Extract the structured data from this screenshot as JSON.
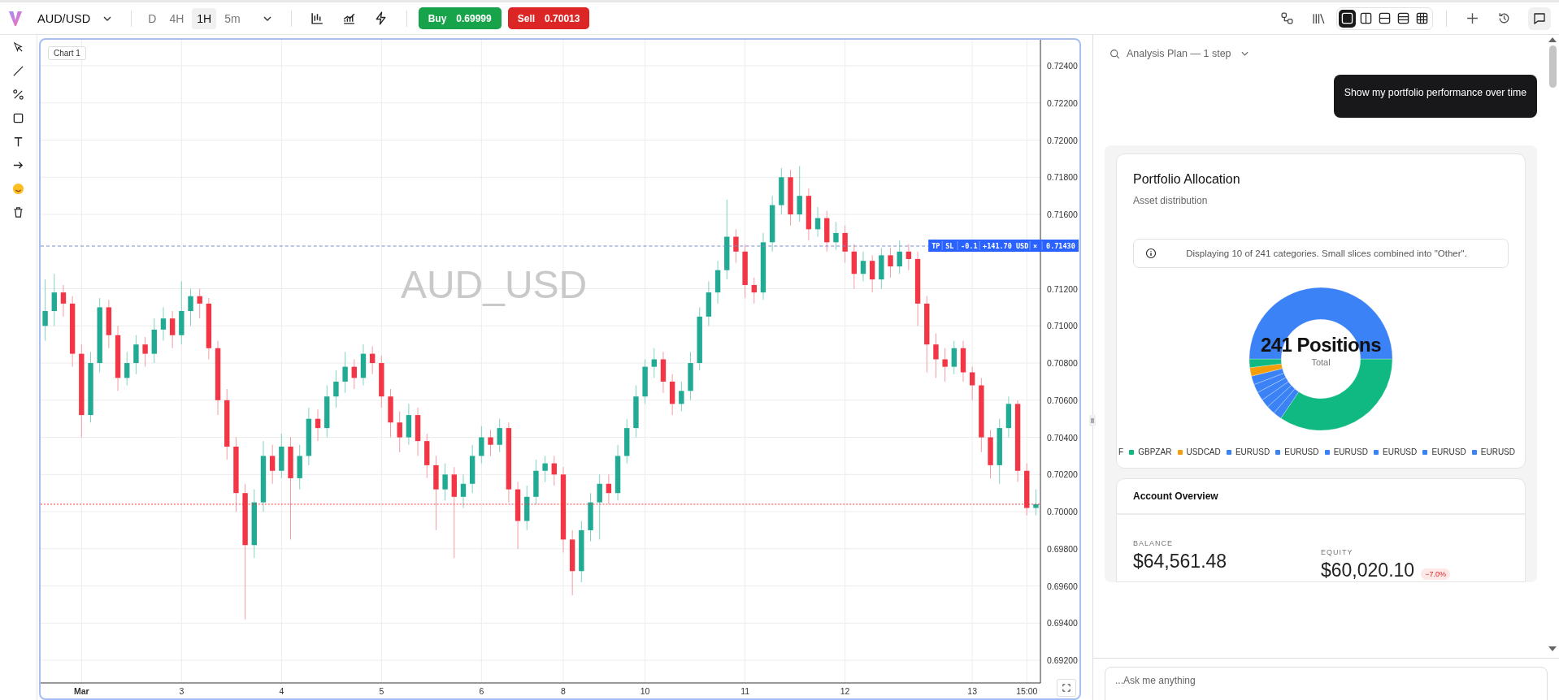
{
  "toolbar": {
    "symbol": "AUD/USD",
    "timeframes": [
      {
        "label": "D",
        "selected": false
      },
      {
        "label": "4H",
        "selected": false
      },
      {
        "label": "1H",
        "selected": true
      },
      {
        "label": "5m",
        "selected": false
      }
    ],
    "buy": {
      "label": "Buy",
      "price": "0.69999"
    },
    "sell": {
      "label": "Sell",
      "price": "0.70013"
    },
    "layouts": [
      {
        "kind": "single",
        "selected": true
      },
      {
        "kind": "columns",
        "selected": false
      },
      {
        "kind": "rows",
        "selected": false
      },
      {
        "kind": "three-rows",
        "selected": false
      },
      {
        "kind": "grid",
        "selected": false
      }
    ],
    "chat_open": true
  },
  "chart": {
    "tag": "Chart 1",
    "watermark": "AUD_USD",
    "chart_data": {
      "type": "candlestick",
      "ylim": [
        0.69078,
        0.7254
      ],
      "grid": true,
      "categories": [
        null,
        null,
        null,
        null,
        "Mar",
        null,
        null,
        null,
        null,
        null,
        null,
        null,
        null,
        null,
        null,
        "3",
        null,
        null,
        null,
        null,
        null,
        null,
        null,
        null,
        null,
        null,
        "4",
        null,
        null,
        null,
        null,
        null,
        null,
        null,
        null,
        null,
        null,
        "5",
        null,
        null,
        null,
        null,
        null,
        null,
        null,
        null,
        null,
        null,
        "6",
        null,
        null,
        null,
        null,
        null,
        null,
        null,
        null,
        "8",
        null,
        null,
        null,
        null,
        null,
        null,
        null,
        null,
        "10",
        null,
        null,
        null,
        null,
        null,
        null,
        null,
        null,
        null,
        null,
        "11",
        null,
        null,
        null,
        null,
        null,
        null,
        null,
        null,
        null,
        null,
        "12",
        null,
        null,
        null,
        null,
        null,
        null,
        null,
        null,
        null,
        null,
        null,
        null,
        null,
        "13",
        null,
        null,
        null,
        null,
        null,
        "15:00",
        null
      ],
      "ohlc": [
        [
          0.71,
          0.7125,
          0.7092,
          0.7108
        ],
        [
          0.7108,
          0.7128,
          0.71,
          0.7118
        ],
        [
          0.7118,
          0.7122,
          0.7105,
          0.7112
        ],
        [
          0.7112,
          0.7116,
          0.7078,
          0.7085
        ],
        [
          0.7085,
          0.709,
          0.704,
          0.7052
        ],
        [
          0.7052,
          0.7086,
          0.7048,
          0.708
        ],
        [
          0.708,
          0.7115,
          0.7075,
          0.711
        ],
        [
          0.711,
          0.7114,
          0.7088,
          0.7095
        ],
        [
          0.7095,
          0.71,
          0.7065,
          0.7072
        ],
        [
          0.7072,
          0.7086,
          0.7068,
          0.708
        ],
        [
          0.708,
          0.7095,
          0.7074,
          0.709
        ],
        [
          0.709,
          0.7094,
          0.7078,
          0.7085
        ],
        [
          0.7085,
          0.7104,
          0.708,
          0.7098
        ],
        [
          0.7098,
          0.711,
          0.7092,
          0.7104
        ],
        [
          0.7104,
          0.7108,
          0.7088,
          0.7095
        ],
        [
          0.7095,
          0.7124,
          0.709,
          0.7108
        ],
        [
          0.7108,
          0.712,
          0.71,
          0.7116
        ],
        [
          0.7116,
          0.712,
          0.7104,
          0.7112
        ],
        [
          0.7112,
          0.7115,
          0.7082,
          0.7088
        ],
        [
          0.7088,
          0.7092,
          0.7052,
          0.706
        ],
        [
          0.706,
          0.7066,
          0.7028,
          0.7035
        ],
        [
          0.7035,
          0.704,
          0.7,
          0.701
        ],
        [
          0.701,
          0.7015,
          0.6942,
          0.6982
        ],
        [
          0.6982,
          0.7012,
          0.6975,
          0.7005
        ],
        [
          0.7005,
          0.7038,
          0.7,
          0.703
        ],
        [
          0.703,
          0.7036,
          0.7015,
          0.7022
        ],
        [
          0.7022,
          0.7042,
          0.7018,
          0.7035
        ],
        [
          0.7035,
          0.704,
          0.6985,
          0.7018
        ],
        [
          0.7018,
          0.7036,
          0.7012,
          0.703
        ],
        [
          0.703,
          0.7056,
          0.7025,
          0.705
        ],
        [
          0.705,
          0.7055,
          0.7038,
          0.7045
        ],
        [
          0.7045,
          0.7068,
          0.704,
          0.7062
        ],
        [
          0.7062,
          0.7076,
          0.7056,
          0.707
        ],
        [
          0.707,
          0.7086,
          0.7064,
          0.7078
        ],
        [
          0.7078,
          0.7082,
          0.7066,
          0.7072
        ],
        [
          0.7072,
          0.709,
          0.7068,
          0.7085
        ],
        [
          0.7085,
          0.7089,
          0.7074,
          0.708
        ],
        [
          0.708,
          0.7084,
          0.7056,
          0.7062
        ],
        [
          0.7062,
          0.7066,
          0.704,
          0.7048
        ],
        [
          0.7048,
          0.7054,
          0.7032,
          0.704
        ],
        [
          0.704,
          0.7058,
          0.7036,
          0.7052
        ],
        [
          0.7052,
          0.7056,
          0.703,
          0.7038
        ],
        [
          0.7038,
          0.7042,
          0.7018,
          0.7025
        ],
        [
          0.7025,
          0.703,
          0.699,
          0.7012
        ],
        [
          0.7012,
          0.7026,
          0.7006,
          0.702
        ],
        [
          0.702,
          0.7024,
          0.6975,
          0.7008
        ],
        [
          0.7008,
          0.702,
          0.7002,
          0.7015
        ],
        [
          0.7015,
          0.7036,
          0.701,
          0.703
        ],
        [
          0.703,
          0.7046,
          0.7026,
          0.704
        ],
        [
          0.704,
          0.7044,
          0.703,
          0.7036
        ],
        [
          0.7036,
          0.705,
          0.7032,
          0.7045
        ],
        [
          0.7045,
          0.7048,
          0.7005,
          0.7012
        ],
        [
          0.7012,
          0.7016,
          0.698,
          0.6995
        ],
        [
          0.6995,
          0.7014,
          0.699,
          0.7008
        ],
        [
          0.7008,
          0.7028,
          0.7004,
          0.7022
        ],
        [
          0.7022,
          0.703,
          0.7016,
          0.7026
        ],
        [
          0.7026,
          0.703,
          0.7014,
          0.702
        ],
        [
          0.702,
          0.7024,
          0.6978,
          0.6985
        ],
        [
          0.6985,
          0.699,
          0.6955,
          0.6968
        ],
        [
          0.6968,
          0.6995,
          0.6962,
          0.699
        ],
        [
          0.699,
          0.701,
          0.6984,
          0.7005
        ],
        [
          0.7005,
          0.702,
          0.6985,
          0.7015
        ],
        [
          0.7015,
          0.702,
          0.7004,
          0.701
        ],
        [
          0.701,
          0.7036,
          0.7006,
          0.703
        ],
        [
          0.703,
          0.705,
          0.7026,
          0.7045
        ],
        [
          0.7045,
          0.7068,
          0.704,
          0.7062
        ],
        [
          0.7062,
          0.7082,
          0.7058,
          0.7078
        ],
        [
          0.7078,
          0.7088,
          0.7072,
          0.7082
        ],
        [
          0.7082,
          0.7086,
          0.7064,
          0.707
        ],
        [
          0.707,
          0.7074,
          0.7052,
          0.7058
        ],
        [
          0.7058,
          0.707,
          0.7054,
          0.7065
        ],
        [
          0.7065,
          0.7086,
          0.706,
          0.708
        ],
        [
          0.708,
          0.711,
          0.7076,
          0.7105
        ],
        [
          0.7105,
          0.7124,
          0.71,
          0.7118
        ],
        [
          0.7118,
          0.7135,
          0.7112,
          0.713
        ],
        [
          0.713,
          0.7168,
          0.7125,
          0.7148
        ],
        [
          0.7148,
          0.7152,
          0.7134,
          0.714
        ],
        [
          0.714,
          0.7144,
          0.7115,
          0.7122
        ],
        [
          0.7122,
          0.7126,
          0.7112,
          0.7118
        ],
        [
          0.7118,
          0.715,
          0.7114,
          0.7145
        ],
        [
          0.7145,
          0.717,
          0.714,
          0.7165
        ],
        [
          0.7165,
          0.7185,
          0.716,
          0.718
        ],
        [
          0.718,
          0.7184,
          0.7154,
          0.716
        ],
        [
          0.716,
          0.7186,
          0.7156,
          0.717
        ],
        [
          0.717,
          0.7174,
          0.7146,
          0.7152
        ],
        [
          0.7152,
          0.7164,
          0.7148,
          0.7158
        ],
        [
          0.7158,
          0.7162,
          0.714,
          0.7145
        ],
        [
          0.7145,
          0.7156,
          0.7141,
          0.715
        ],
        [
          0.715,
          0.7154,
          0.7134,
          0.714
        ],
        [
          0.714,
          0.7144,
          0.712,
          0.7128
        ],
        [
          0.7128,
          0.714,
          0.7124,
          0.7135
        ],
        [
          0.7135,
          0.7138,
          0.7118,
          0.7125
        ],
        [
          0.7125,
          0.7142,
          0.712,
          0.7138
        ],
        [
          0.7138,
          0.7142,
          0.7126,
          0.7132
        ],
        [
          0.7132,
          0.7146,
          0.7128,
          0.714
        ],
        [
          0.714,
          0.7144,
          0.713,
          0.7136
        ],
        [
          0.7136,
          0.714,
          0.71,
          0.7112
        ],
        [
          0.7112,
          0.7116,
          0.7075,
          0.709
        ],
        [
          0.709,
          0.7096,
          0.7072,
          0.7082
        ],
        [
          0.7082,
          0.7088,
          0.707,
          0.7078
        ],
        [
          0.7078,
          0.7092,
          0.7074,
          0.7088
        ],
        [
          0.7088,
          0.7092,
          0.707,
          0.7075
        ],
        [
          0.7075,
          0.7078,
          0.706,
          0.7068
        ],
        [
          0.7068,
          0.7072,
          0.7032,
          0.704
        ],
        [
          0.704,
          0.7044,
          0.7018,
          0.7025
        ],
        [
          0.7025,
          0.705,
          0.7015,
          0.7045
        ],
        [
          0.7045,
          0.7062,
          0.704,
          0.7058
        ],
        [
          0.7058,
          0.706,
          0.7016,
          0.7022
        ],
        [
          0.7022,
          0.7026,
          0.6998,
          0.7002
        ],
        [
          0.7002,
          0.7012,
          0.6998,
          0.7004
        ]
      ],
      "yticks": [
        {
          "value": 0.724,
          "label": "0.72400"
        },
        {
          "value": 0.722,
          "label": "0.72200"
        },
        {
          "value": 0.72,
          "label": "0.72000"
        },
        {
          "value": 0.718,
          "label": "0.71800"
        },
        {
          "value": 0.716,
          "label": "0.71600"
        },
        {
          "value": 0.712,
          "label": "0.71200"
        },
        {
          "value": 0.71,
          "label": "0.71000"
        },
        {
          "value": 0.708,
          "label": "0.70800"
        },
        {
          "value": 0.706,
          "label": "0.70600"
        },
        {
          "value": 0.704,
          "label": "0.70400"
        },
        {
          "value": 0.702,
          "label": "0.70200"
        },
        {
          "value": 0.7,
          "label": "0.70000"
        },
        {
          "value": 0.698,
          "label": "0.69800"
        },
        {
          "value": 0.696,
          "label": "0.69600"
        },
        {
          "value": 0.694,
          "label": "0.69400"
        },
        {
          "value": 0.692,
          "label": "0.69200"
        }
      ]
    },
    "order": {
      "tp": "TP",
      "sl": "SL",
      "qty": "-0.1",
      "pnl": "+141.70 USD",
      "close": "×",
      "price": "0.71430"
    }
  },
  "panel": {
    "plan": "Analysis Plan — 1 step",
    "message": "Show my portfolio performance over time",
    "allocation": {
      "title": "Portfolio Allocation",
      "subtitle": "Asset distribution",
      "notice": "Displaying 10 of 241 categories. Small slices combined into \"Other\".",
      "center": "241 Positions",
      "center_sub": "Total",
      "legend": [
        {
          "label": "F"
        },
        {
          "label": "GBPZAR",
          "color": "#10b981"
        },
        {
          "label": "USDCAD",
          "color": "#f59e0b"
        },
        {
          "label": "EURUSD",
          "color": "#3b82f6"
        },
        {
          "label": "EURUSD",
          "color": "#3b82f6"
        },
        {
          "label": "EURUSD",
          "color": "#3b82f6"
        },
        {
          "label": "EURUSD",
          "color": "#3b82f6"
        },
        {
          "label": "EURUSD",
          "color": "#3b82f6"
        },
        {
          "label": "EURUSD",
          "color": "#3b82f6"
        }
      ]
    },
    "overview": {
      "title": "Account Overview",
      "stats": [
        {
          "label": "BALANCE",
          "value": "$64,561.48"
        },
        {
          "label": "EQUITY",
          "value": "$60,020.10",
          "change": "−7.0%"
        }
      ]
    },
    "input": {
      "placeholder": "...Ask me anything"
    }
  }
}
